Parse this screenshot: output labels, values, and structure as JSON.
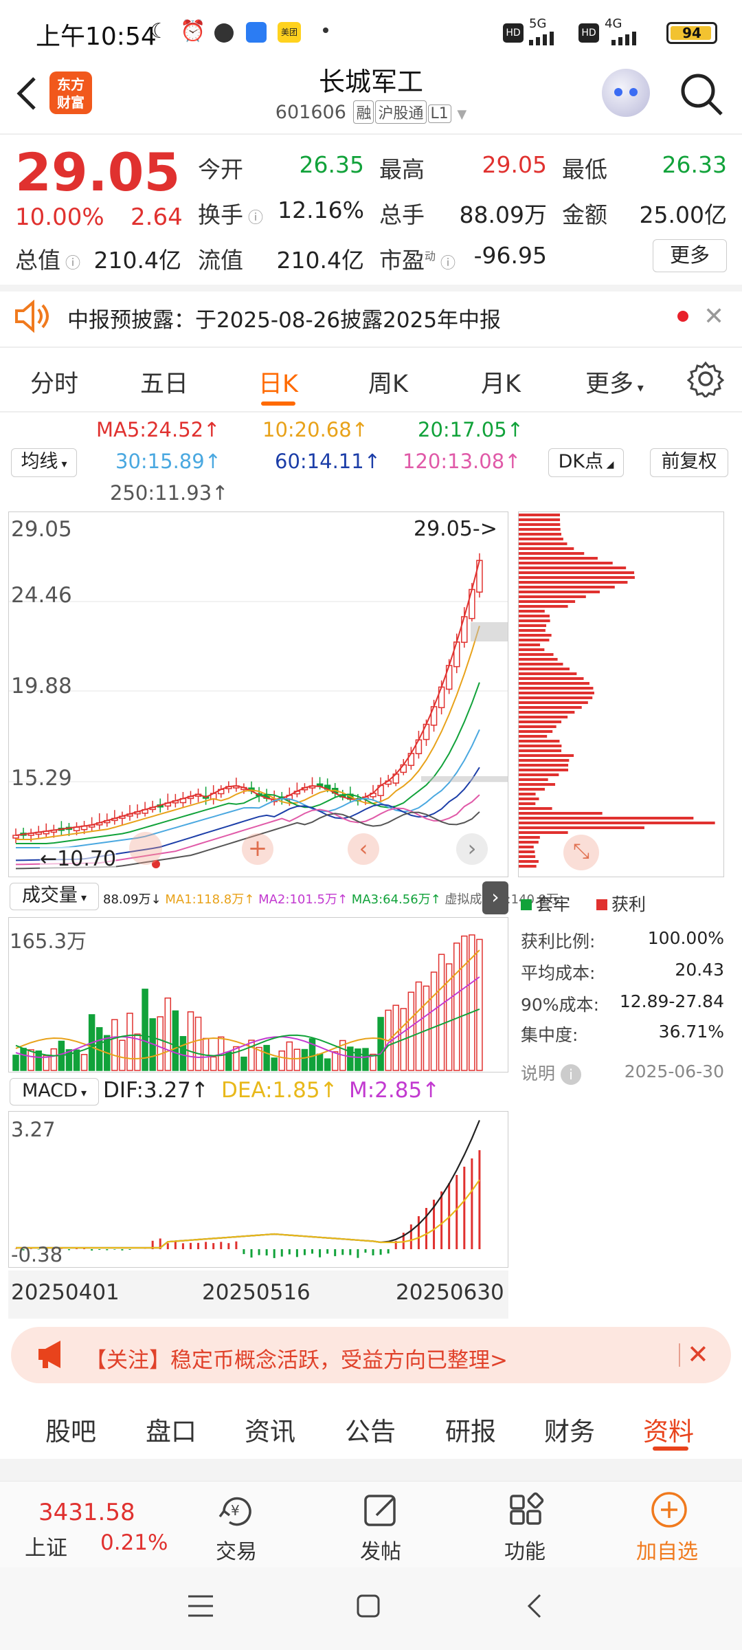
{
  "status_bar": {
    "time": "上午10:54",
    "battery": "94",
    "net1": "5G",
    "net2": "4G"
  },
  "header": {
    "title": "长城军工",
    "code": "601606",
    "tags": [
      "融",
      "沪股通",
      "L1"
    ],
    "logo_text": [
      "东方",
      "财富"
    ]
  },
  "quote": {
    "price": "29.05",
    "change_pct": "10.00%",
    "change": "2.64",
    "open_label": "今开",
    "open": "26.35",
    "high_label": "最高",
    "high": "29.05",
    "low_label": "最低",
    "low": "26.33",
    "turnover_label": "换手",
    "turnover": "12.16%",
    "volume_label": "总手",
    "volume": "88.09万",
    "amount_label": "金额",
    "amount": "25.00亿",
    "mktcap_label": "总值",
    "mktcap": "210.4亿",
    "float_label": "流值",
    "float": "210.4亿",
    "pe_label": "市盈",
    "pe_sup": "动",
    "pe": "-96.95",
    "more": "更多"
  },
  "notice": {
    "text": "中报预披露：于2025-08-26披露2025年中报"
  },
  "period_tabs": [
    "分时",
    "五日",
    "日K",
    "周K",
    "月K",
    "更多"
  ],
  "active_tab": "日K",
  "ma": {
    "selector": "均线",
    "ma5": "MA5:24.52↑",
    "ma10": "10:20.68↑",
    "ma20": "20:17.05↑",
    "ma30": "30:15.89↑",
    "ma60": "60:14.11↑",
    "ma120": "120:13.08↑",
    "ma250": "250:11.93↑",
    "dk": "DK点",
    "adjust": "前复权"
  },
  "kline": {
    "y_labels": [
      "29.05",
      "24.46",
      "19.88",
      "15.29",
      "10.70"
    ],
    "last_price_tag": "29.05->",
    "low_tag": "10.70"
  },
  "volume_panel": {
    "selector": "成交量",
    "legend": [
      "88.09万↓",
      "MA1:118.8万↑",
      "MA2:101.5万↑",
      "MA3:64.56万↑",
      "虚拟成交量:140.9万"
    ],
    "y_label": "165.3万"
  },
  "chip": {
    "legend_trapped": "套牢",
    "legend_profit": "获利",
    "rows": [
      {
        "label": "获利比例:",
        "value": "100.00%"
      },
      {
        "label": "平均成本:",
        "value": "20.43"
      },
      {
        "label": "90%成本:",
        "value": "12.89-27.84"
      },
      {
        "label": "集中度:",
        "value": "36.71%"
      }
    ],
    "note": "说明",
    "date": "2025-06-30"
  },
  "macd": {
    "selector": "MACD",
    "dif": "DIF:3.27↑",
    "dea": "DEA:1.85↑",
    "m": "M:2.85↑",
    "y_top": "3.27",
    "y_bottom": "-0.38",
    "dates": [
      "20250401",
      "20250516",
      "20250630"
    ]
  },
  "banner": {
    "text": "【关注】稳定币概念活跃，受益方向已整理>"
  },
  "bottom_tabs": [
    "股吧",
    "盘口",
    "资讯",
    "公告",
    "研报",
    "财务",
    "资料"
  ],
  "active_bottom_tab": "资料",
  "nav": {
    "index_value": "3431.58",
    "index_name": "上证",
    "index_change": "0.21%",
    "items": [
      "交易",
      "发帖",
      "功能",
      "加自选"
    ]
  },
  "colors": {
    "up": "#e0312f",
    "down": "#11a23a",
    "accent": "#ff6a00"
  }
}
